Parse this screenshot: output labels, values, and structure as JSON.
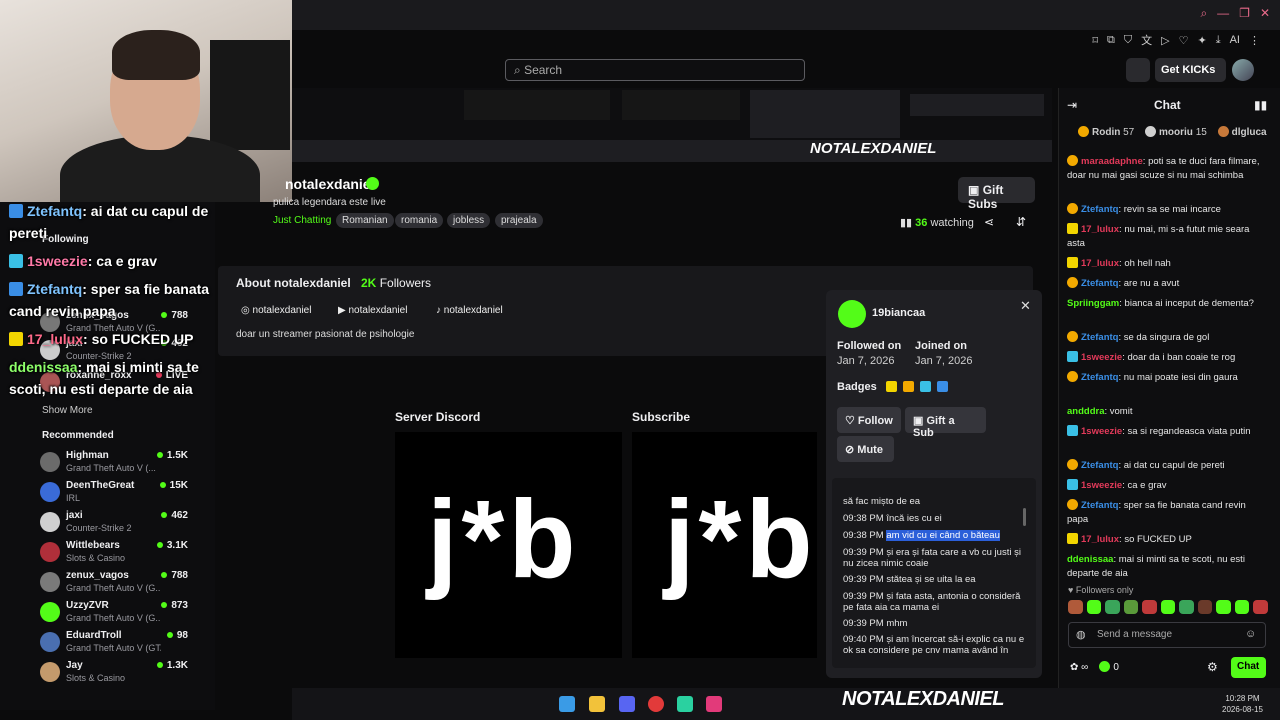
{
  "header": {
    "search_placeholder": "Search",
    "get_kicks": "Get KICKs"
  },
  "overlay_chat": [
    {
      "user": "Ztefantq",
      "text": "ai dat cu capul de"
    },
    {
      "user": "",
      "text": "pereti"
    },
    {
      "user": "1sweezie",
      "text": "ca e grav"
    },
    {
      "user": "Ztefantq",
      "text": "sper sa fie banata"
    },
    {
      "user": "",
      "text": "cand revin papa"
    },
    {
      "user": "17_lulux",
      "text": "so FUCKED UP"
    },
    {
      "user": "ddenissaa",
      "text": "mai si minti sa te"
    },
    {
      "user": "",
      "text": "scoti, nu esti departe de aia"
    }
  ],
  "sidebar": {
    "following_label": "Following",
    "show_more": "Show More",
    "recommended_label": "Recommended",
    "following": [
      {
        "name": "zenux_vagos",
        "game": "Grand Theft Auto V (G...",
        "count": "788"
      },
      {
        "name": "jaxi",
        "game": "Counter-Strike 2",
        "count": "462"
      },
      {
        "name": "roxanne_roxx",
        "game": "",
        "count": "LIVE"
      }
    ],
    "recommended": [
      {
        "name": "Highman",
        "game": "Grand Theft Auto V (...",
        "count": "1.5K",
        "color": "#6b6b6b"
      },
      {
        "name": "DeenTheGreat",
        "game": "IRL",
        "count": "15K",
        "color": "#3a6bd8"
      },
      {
        "name": "jaxi",
        "game": "Counter-Strike 2",
        "count": "462",
        "color": "#d0d0d0"
      },
      {
        "name": "Wittlebears",
        "game": "Slots & Casino",
        "count": "3.1K",
        "color": "#b02f3a"
      },
      {
        "name": "zenux_vagos",
        "game": "Grand Theft Auto V (G...",
        "count": "788",
        "color": "#7a7a7a"
      },
      {
        "name": "UzzyZVR",
        "game": "Grand Theft Auto V (G...",
        "count": "873",
        "color": "#53fc18"
      },
      {
        "name": "EduardTroll",
        "game": "Grand Theft Auto V (GTA)",
        "count": "98",
        "color": "#4a6fb0"
      },
      {
        "name": "Jay",
        "game": "Slots & Casino",
        "count": "1.3K",
        "color": "#c49a6c"
      }
    ]
  },
  "channel": {
    "name": "notalexdaniel",
    "title": "pulica legendara este live",
    "category": "Just Chatting",
    "tags": [
      "Romanian",
      "romania",
      "jobless",
      "prajeala"
    ],
    "gift_subs": "Gift Subs",
    "watching_count": "36",
    "watching_label": "watching"
  },
  "about": {
    "title": "About notalexdaniel",
    "followers_count": "2K",
    "followers_label": "Followers",
    "socials": [
      "notalexdaniel",
      "notalexdaniel",
      "notalexdaniel"
    ],
    "bio": "doar un streamer pasionat de psihologie"
  },
  "panels": [
    {
      "title": "Server Discord",
      "art": "j*b"
    },
    {
      "title": "Subscribe",
      "art": "j*b"
    }
  ],
  "user_card": {
    "name": "19biancaa",
    "followed_on_label": "Followed on",
    "followed_on": "Jan 7, 2026",
    "joined_on_label": "Joined on",
    "joined_on": "Jan 7, 2026",
    "badges_label": "Badges",
    "follow": "Follow",
    "gift_sub": "Gift a Sub",
    "mute": "Mute",
    "log": [
      {
        "time": "",
        "text": "să fac mișto de ea"
      },
      {
        "time": "09:38 PM",
        "text": "încă ies cu ei"
      },
      {
        "time": "09:38 PM",
        "text": "am vid cu ei când o băteau"
      },
      {
        "time": "09:39 PM",
        "text": "și era și fata care a vb cu justi și nu zicea nimic coaie"
      },
      {
        "time": "09:39 PM",
        "text": "stătea și se uita la ea"
      },
      {
        "time": "09:39 PM",
        "text": "și fata asta, antonia o consideră pe fata aia ca mama ei"
      },
      {
        "time": "09:39 PM",
        "text": "mhm"
      },
      {
        "time": "09:40 PM",
        "text": "și am încercat să-i explic ca nu e ok sa considere pe cnv mama având în"
      }
    ]
  },
  "chat": {
    "title": "Chat",
    "pinned": [
      {
        "name": "Rodin",
        "value": "57"
      },
      {
        "name": "mooriu",
        "value": "15"
      },
      {
        "name": "dlgluca",
        "value": ""
      }
    ],
    "messages": [
      {
        "user": "maraadaphne",
        "color": "#e23a5a",
        "text": "poti sa te duci fara filmare, doar nu mai gasi scuze si nu mai schimba",
        "badge": "#f2a900"
      },
      {
        "user": "Ztefantq",
        "color": "#3a8ee6",
        "text": "revin sa se mai incarce",
        "badge": "#f2a900"
      },
      {
        "user": "17_lulux",
        "color": "#e23a5a",
        "text": "nu mai, mi s-a futut mie seara asta",
        "badge": "#f2d500"
      },
      {
        "user": "17_lulux",
        "color": "#e23a5a",
        "text": "oh hell nah",
        "badge": "#f2d500"
      },
      {
        "user": "Ztefantq",
        "color": "#3a8ee6",
        "text": "are nu a avut",
        "badge": "#f2a900"
      },
      {
        "user": "Spriinggam",
        "color": "#53fc18",
        "text": "bianca ai inceput de dementa?",
        "badge": ""
      },
      {
        "user": "Ztefantq",
        "color": "#3a8ee6",
        "text": "se da singura de gol",
        "badge": "#f2a900"
      },
      {
        "user": "1sweezie",
        "color": "#e23a5a",
        "text": "doar da i ban coaie te rog",
        "badge": "#3ac0e6"
      },
      {
        "user": "Ztefantq",
        "color": "#3a8ee6",
        "text": "nu mai poate iesi din gaura",
        "badge": "#f2a900"
      },
      {
        "user": "andddra",
        "color": "#53fc18",
        "text": "vomit",
        "badge": ""
      },
      {
        "user": "1sweezie",
        "color": "#e23a5a",
        "text": "sa si regandeasca viata putin",
        "badge": "#3ac0e6"
      },
      {
        "user": "Ztefantq",
        "color": "#3a8ee6",
        "text": "ai dat cu capul de pereti",
        "badge": "#f2a900"
      },
      {
        "user": "1sweezie",
        "color": "#e23a5a",
        "text": "ca e grav",
        "badge": "#3ac0e6"
      },
      {
        "user": "Ztefantq",
        "color": "#3a8ee6",
        "text": "sper sa fie banata cand revin papa",
        "badge": "#f2a900"
      },
      {
        "user": "17_lulux",
        "color": "#e23a5a",
        "text": "so FUCKED UP",
        "badge": "#f2d500"
      },
      {
        "user": "ddenissaa",
        "color": "#53fc18",
        "text": "mai si minti sa te scoti, nu esti departe de aia",
        "badge": ""
      }
    ],
    "followers_only": "Followers only",
    "input_placeholder": "Send a message",
    "points": "0",
    "send": "Chat"
  },
  "overlay_brand": "NOTALEXDANIEL",
  "taskbar": {
    "time": "10:28 PM",
    "date": "2026-08-15"
  }
}
